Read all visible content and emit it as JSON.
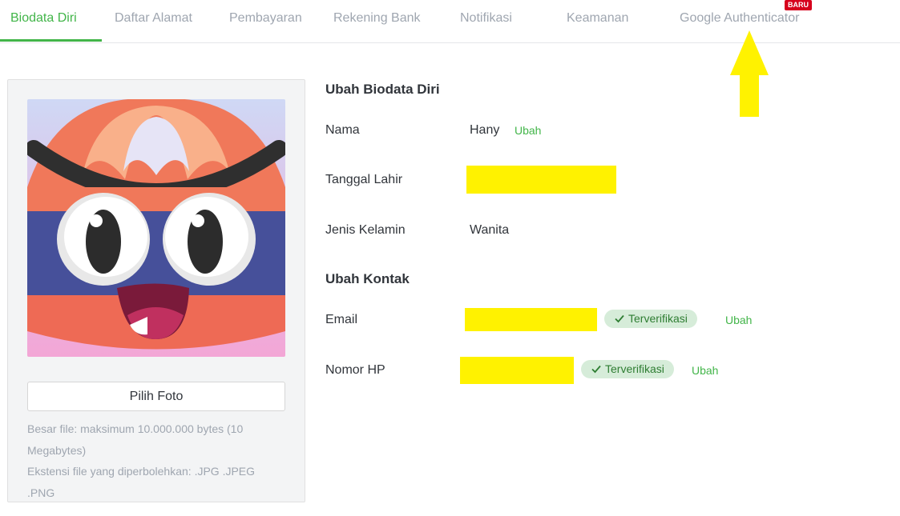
{
  "tabs": [
    {
      "label": "Biodata Diri"
    },
    {
      "label": "Daftar Alamat"
    },
    {
      "label": "Pembayaran"
    },
    {
      "label": "Rekening Bank"
    },
    {
      "label": "Notifikasi"
    },
    {
      "label": "Keamanan"
    },
    {
      "label": "Google Authenticator",
      "badge": "BARU"
    }
  ],
  "photo": {
    "pick_button": "Pilih Foto",
    "file_size_note": "Besar file: maksimum 10.000.000 bytes (10 Megabytes)",
    "extension_note": "Ekstensi file yang diperbolehkan: .JPG .JPEG .PNG"
  },
  "biodata": {
    "title": "Ubah Biodata Diri",
    "name_label": "Nama",
    "name_value": "Hany",
    "dob_label": "Tanggal Lahir",
    "gender_label": "Jenis Kelamin",
    "gender_value": "Wanita"
  },
  "contact": {
    "title": "Ubah Kontak",
    "email_label": "Email",
    "phone_label": "Nomor HP",
    "verified_label": "Terverifikasi"
  },
  "actions": {
    "edit_label": "Ubah"
  },
  "colors": {
    "accent": "#42b549",
    "badge": "#d6001c",
    "highlight": "#fff200"
  }
}
